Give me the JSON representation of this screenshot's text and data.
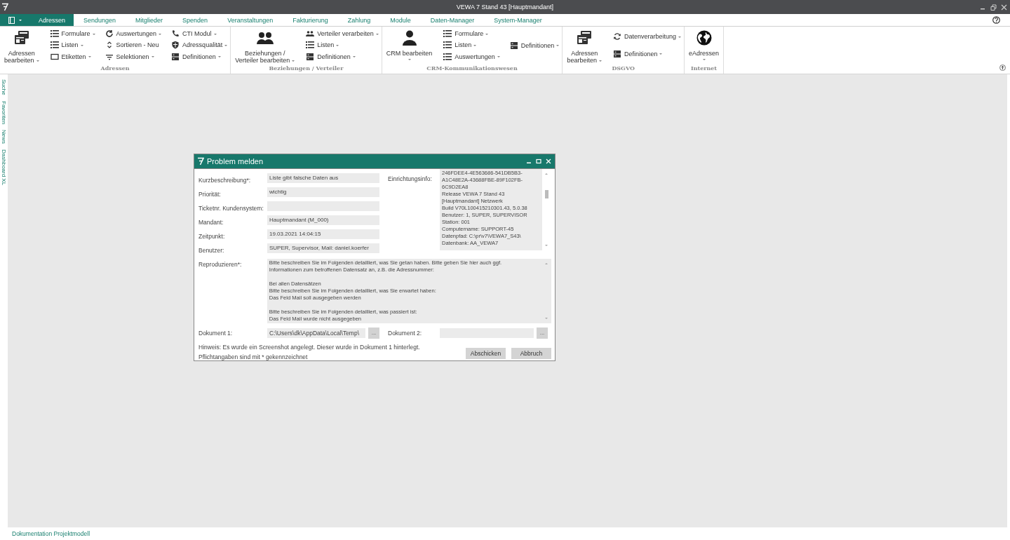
{
  "window": {
    "title": "VEWA 7 Stand 43 [Hauptmandant]"
  },
  "tabs": [
    {
      "label": "Adressen",
      "selected": true
    },
    {
      "label": "Sendungen",
      "selected": false
    },
    {
      "label": "Mitglieder",
      "selected": false
    },
    {
      "label": "Spenden",
      "selected": false
    },
    {
      "label": "Veranstaltungen",
      "selected": false
    },
    {
      "label": "Fakturierung",
      "selected": false
    },
    {
      "label": "Zahlung",
      "selected": false
    },
    {
      "label": "Module",
      "selected": false
    },
    {
      "label": "Daten-Manager",
      "selected": false
    },
    {
      "label": "System-Manager",
      "selected": false
    }
  ],
  "ribbon": {
    "groups": [
      {
        "label": "Adressen",
        "large": {
          "label": "Adressen\nbearbeiten",
          "dropdown": true
        },
        "columns": [
          [
            {
              "label": "Formulare",
              "dropdown": true
            },
            {
              "label": "Listen",
              "dropdown": true
            },
            {
              "label": "Etiketten",
              "dropdown": true
            }
          ],
          [
            {
              "label": "Auswertungen",
              "dropdown": true
            },
            {
              "label": "Sortieren - Neu",
              "dropdown": false
            },
            {
              "label": "Selektionen",
              "dropdown": true
            }
          ],
          [
            {
              "label": "CTI Modul",
              "dropdown": true
            },
            {
              "label": "Adressqualität",
              "dropdown": true
            },
            {
              "label": "Definitionen",
              "dropdown": true
            }
          ]
        ]
      },
      {
        "label": "Beziehungen / Verteiler",
        "large": {
          "label": "Beziehungen /\nVerteiler bearbeiten",
          "dropdown": true
        },
        "columns": [
          [
            {
              "label": "Verteiler verarbeiten",
              "dropdown": true
            },
            {
              "label": "Listen",
              "dropdown": true
            },
            {
              "label": "Definitionen",
              "dropdown": true
            }
          ]
        ]
      },
      {
        "label": "CRM-Kommunikationswesen",
        "large": {
          "label": "CRM bearbeiten",
          "dropdown": true,
          "dropdown_below": true
        },
        "columns": [
          [
            {
              "label": "Formulare",
              "dropdown": true
            },
            {
              "label": "Listen",
              "dropdown": true
            },
            {
              "label": "Auswertungen",
              "dropdown": true
            }
          ],
          [
            {
              "label": "Definitionen",
              "dropdown": true
            }
          ]
        ]
      },
      {
        "label": "DSGVO",
        "large": {
          "label": "Adressen\nbearbeiten",
          "dropdown": true
        },
        "columns": [
          [
            {
              "label": "Datenverarbeitung",
              "dropdown": true
            },
            {
              "label": "Definitionen",
              "dropdown": true
            }
          ]
        ]
      },
      {
        "label": "Internet",
        "large": {
          "label": "eAdressen",
          "dropdown": true,
          "dropdown_below": true
        }
      }
    ]
  },
  "side_tabs": [
    "Suche",
    "Favoriten",
    "News",
    "Dashboard XL"
  ],
  "dialog": {
    "title": "Problem melden",
    "fields": [
      {
        "label": "Kurzbeschreibung*:",
        "value": "Liste gibt falsche Daten aus"
      },
      {
        "label": "Priorität:",
        "value": "wichtig"
      },
      {
        "label": "Ticketnr. Kundensystem:"
      },
      {
        "label": "Mandant:",
        "value": "Hauptmandant (M_000)"
      },
      {
        "label": "Zeitpunkt:",
        "value": "19.03.2021 14:04:15"
      },
      {
        "label": "Benutzer:",
        "value": "SUPER, Supervisor, Mail: daniel.koerfer"
      }
    ],
    "info": {
      "label": "Einrichtungsinfo:",
      "lines": [
        "246FDEE4-4E563686-541DB5B3-",
        "A1C48E2A-43688FBE-89F102FB-",
        "6C9D2EA8",
        "Release VEWA 7 Stand 43",
        "[Hauptmandant] Netzwerk",
        "Build V70L100415210301.43, 5.0.38",
        "Benutzer: 1, SUPER, SUPERVISOR",
        "Station: 001",
        "Computername: SUPPORT-45",
        "Datenpfad: C:\\pr\\v7\\VEWA7_S43\\",
        "Datenbank: AA_VEWA7"
      ]
    },
    "reproduce": {
      "label": "Reproduzieren*:",
      "paragraphs": [
        [
          "Bitte beschreiben Sie im Folgenden detailliert, was Sie getan haben. Bitte geben Sie hier auch ggf.",
          "Informationen zum betroffenen Datensatz an, z.B. die Adressnummer:"
        ],
        [
          "Bei allen Datensätzen",
          "Bitte beschreiben Sie im Folgenden detailliert, was Sie erwartet haben:",
          "Das Feld Mail soll ausgegeben werden"
        ],
        [
          "Bitte beschreiben Sie im Folgenden detailliert, was passiert ist:",
          "Das Feld Mail wurde nicht ausgegeben"
        ]
      ]
    },
    "documents": [
      {
        "label": "Dokument 1:",
        "value": "C:\\Users\\dk\\AppData\\Local\\Temp\\",
        "browse": "..."
      },
      {
        "label": "Dokument 2:",
        "browse": "..."
      }
    ],
    "notes": [
      "Hinweis: Es wurde ein Screenshot angelegt. Dieser wurde in Dokument 1 hinterlegt.",
      "Pflichtangaben sind mit * gekennzeichnet"
    ],
    "buttons": [
      "Abschicken",
      "Abbruch"
    ]
  },
  "footer_link": "Dokumentation Projektmodell"
}
